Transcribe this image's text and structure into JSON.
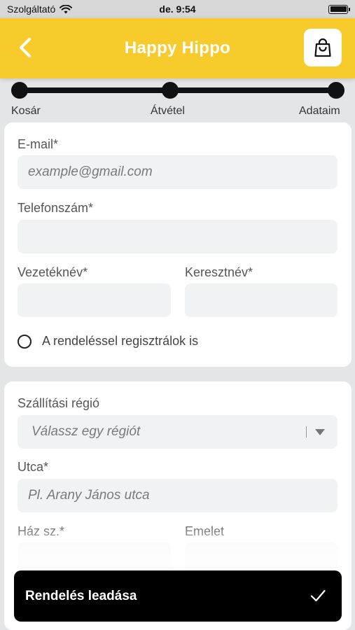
{
  "status_bar": {
    "carrier": "Szolgáltató",
    "time": "de. 9:54"
  },
  "header": {
    "title": "Happy Hippo"
  },
  "stepper": {
    "steps": [
      "Kosár",
      "Átvétel",
      "Adataim"
    ]
  },
  "contact": {
    "email_label": "E-mail*",
    "email_placeholder": "example@gmail.com",
    "phone_label": "Telefonszám*",
    "lastname_label": "Vezetéknév*",
    "firstname_label": "Keresztnév*",
    "register_label": "A rendeléssel regisztrálok is"
  },
  "shipping": {
    "region_label": "Szállítási régió",
    "region_placeholder": "Válassz egy régiót",
    "street_label": "Utca*",
    "street_placeholder": "Pl. Arany János utca",
    "house_label": "Ház sz.*",
    "floor_label": "Emelet"
  },
  "order_button": {
    "label": "Rendelés leadása"
  },
  "colors": {
    "header_bg": "#f7cb2c",
    "button_bg": "#000000"
  }
}
